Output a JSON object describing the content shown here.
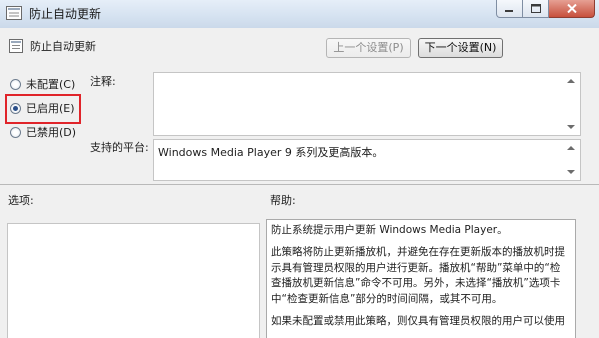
{
  "window": {
    "title": "防止自动更新",
    "buttons": {
      "minimize": "minimize",
      "maximize": "maximize",
      "close": "close"
    }
  },
  "policy": {
    "name": "防止自动更新"
  },
  "nav": {
    "prev_label": "上一个设置(P)",
    "next_label": "下一个设置(N)"
  },
  "options": [
    {
      "label": "未配置(C)",
      "checked": false
    },
    {
      "label": "已启用(E)",
      "checked": true
    },
    {
      "label": "已禁用(D)",
      "checked": false
    }
  ],
  "comment": {
    "label": "注释:",
    "value": ""
  },
  "platform": {
    "label": "支持的平台:",
    "value": "Windows Media Player 9 系列及更高版本。"
  },
  "options_section": {
    "label": "选项:"
  },
  "help": {
    "label": "帮助:",
    "paragraphs": [
      "防止系统提示用户更新 Windows Media Player。",
      "此策略将防止更新播放机，并避免在存在更新版本的播放机时提示具有管理员权限的用户进行更新。播放机“帮助”菜单中的“检查播放机更新信息”命令不可用。另外，未选择“播放机”选项卡中“检查更新信息”部分的时间间隔，或其不可用。",
      "如果未配置或禁用此策略，则仅具有管理员权限的用户可以使用"
    ]
  },
  "colors": {
    "highlight": "#e0242a",
    "accent": "#2a4f8a"
  }
}
